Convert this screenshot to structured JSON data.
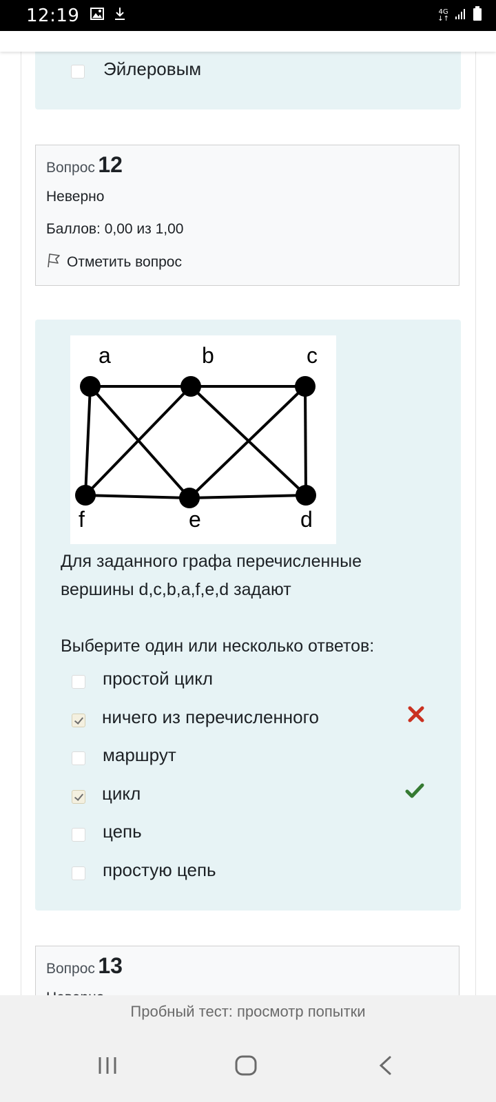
{
  "status_bar": {
    "time": "12:19",
    "network": "4G",
    "icons": [
      "image-icon",
      "download-icon",
      "signal-icon",
      "battery-icon"
    ]
  },
  "prev_question": {
    "last_option": "Эйлеровым"
  },
  "question12": {
    "label": "Вопрос",
    "number": "12",
    "state": "Неверно",
    "grade": "Баллов: 0,00 из 1,00",
    "flag_label": "Отметить вопрос",
    "graph_vertices": [
      "a",
      "b",
      "c",
      "f",
      "e",
      "d"
    ],
    "text_line1": "Для заданного графа перечисленные",
    "text_line2": "вершины d,c,b,a,f,e,d задают",
    "prompt": "Выберите один или несколько ответов:",
    "options": [
      {
        "label": "простой цикл",
        "checked": false,
        "mark": ""
      },
      {
        "label": "ничего из перечисленного",
        "checked": true,
        "mark": "incorrect"
      },
      {
        "label": "маршрут",
        "checked": false,
        "mark": ""
      },
      {
        "label": "цикл",
        "checked": true,
        "mark": "correct"
      },
      {
        "label": "цепь",
        "checked": false,
        "mark": ""
      },
      {
        "label": "простую цепь",
        "checked": false,
        "mark": ""
      }
    ]
  },
  "question13": {
    "label": "Вопрос",
    "number": "13",
    "state": "Неверно"
  },
  "footer": {
    "title": "Пробный тест: просмотр попытки"
  },
  "nav": [
    "recent-apps-icon",
    "home-icon",
    "back-icon"
  ],
  "colors": {
    "incorrect": "#ca3120",
    "correct": "#357a32",
    "answer_bg": "#e7f3f5",
    "info_bg": "#f8f9fa"
  }
}
